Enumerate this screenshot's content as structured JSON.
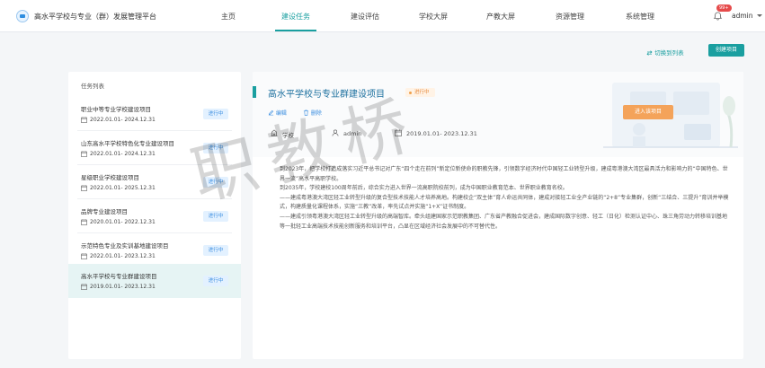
{
  "header": {
    "app_title": "高水平学校与专业（群）发展管理平台",
    "nav": [
      {
        "label": "主页"
      },
      {
        "label": "建设任务"
      },
      {
        "label": "建设评估"
      },
      {
        "label": "学校大屏"
      },
      {
        "label": "产教大屏"
      },
      {
        "label": "资源管理"
      },
      {
        "label": "系统管理"
      }
    ],
    "active_nav": "建设任务",
    "notification_count": "99+",
    "user": "admin",
    "accent_color": "#1a9fa0"
  },
  "toolbar": {
    "switch_view": "切换到列表",
    "create_button": "创建项目"
  },
  "task_list": {
    "title": "任务列表",
    "items": [
      {
        "name": "职业中等专业学校建设项目",
        "date": "2022.01.01- 2024.12.31",
        "status": "进行中"
      },
      {
        "name": "山东高水平学校特色化专业建设项目",
        "date": "2022.01.01- 2024.12.31",
        "status": "进行中"
      },
      {
        "name": "星级职业学校建设项目",
        "date": "2022.01.01- 2025.12.31",
        "status": "进行中"
      },
      {
        "name": "品牌专业建设项目",
        "date": "2020.01.01- 2022.12.31",
        "status": "进行中"
      },
      {
        "name": "示范特色专业及实训基地建设项目",
        "date": "2022.01.01- 2023.12.31",
        "status": "进行中"
      },
      {
        "name": "高水平学校与专业群建设项目",
        "date": "2019.01.01- 2023.12.31",
        "status": "进行中"
      }
    ],
    "selected_index": 5
  },
  "detail": {
    "title": "高水平学校与专业群建设项目",
    "status": "进行中",
    "edit_label": "编辑",
    "delete_label": "删除",
    "level": "学校",
    "owner": "admin",
    "date_range": "2019.01.01- 2023.12.31",
    "enter_button": "进入该项目",
    "description": [
      "到2023年，把学校打造成落实习近平总书记对广东“四个走在前列”新定位新使命的职教先锋，引领数字经济时代中国轻工业转型升级，建成粤港澳大湾区最具活力和影响力的“中国特色、世界一流”高水平高职学校。",
      "到2035年，学校建校100周年前后，综合实力进入世界一流高职院校前列，成为中国职业教育范本、世界职业教育名校。",
      "——建成粤港澳大湾区轻工业转型升级的复合型技术技能人才培养高地。构建校企“双主体”育人命运共同体，建成对接轻工业全产业链的“2+8”专业集群，创新“三结合、三提升”育训并举模式，构建质量化课程体系，实施“三教”改革，率先试点并实施“1+X”证书制度。",
      "——建成引领粤港澳大湾区轻工业转型升级的高端智库。牵头组建国家示范职教集团、广东省产教融合促进会，建成国际数字创意、轻工（日化）检测认证中心、珠三角劳动力转移培训基地等一批轻工业高端技术技能创新服务和培训平台，凸显在区域经济社会发展中的不可替代性。"
    ]
  },
  "watermark": "职教桥",
  "icons": {
    "logo": "school-logo-icon",
    "bell": "bell-icon",
    "switch": "swap-icon",
    "edit": "edit-icon",
    "delete": "trash-icon",
    "level": "building-icon",
    "user": "user-icon",
    "calendar": "calendar-icon"
  }
}
